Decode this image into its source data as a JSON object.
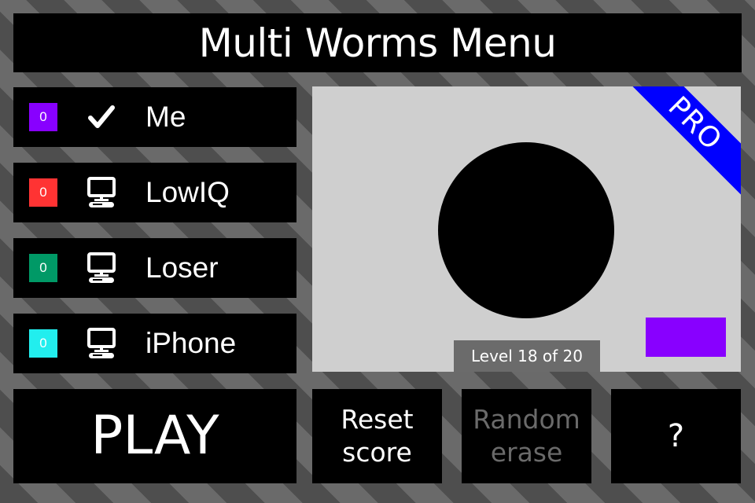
{
  "title": "Multi Worms Menu",
  "players": [
    {
      "score": "0",
      "name": "Me",
      "type": "human",
      "icon": "checkmark-icon",
      "color": "#8800ff"
    },
    {
      "score": "0",
      "name": "LowIQ",
      "type": "computer",
      "icon": "computer-icon",
      "color": "#ff3333"
    },
    {
      "score": "0",
      "name": "Loser",
      "type": "computer",
      "icon": "computer-icon",
      "color": "#009966"
    },
    {
      "score": "0",
      "name": "iPhone",
      "type": "computer",
      "icon": "computer-icon",
      "color": "#22eeee"
    }
  ],
  "preview": {
    "badge": "PRO",
    "badge_color": "#0000ff",
    "level_label": "Level 18 of 20",
    "current_level": 18,
    "total_levels": 20,
    "worm_color": "#8800ff"
  },
  "buttons": {
    "play": "PLAY",
    "reset": "Reset\nscore",
    "random": "Random\nerase",
    "help": "?"
  }
}
